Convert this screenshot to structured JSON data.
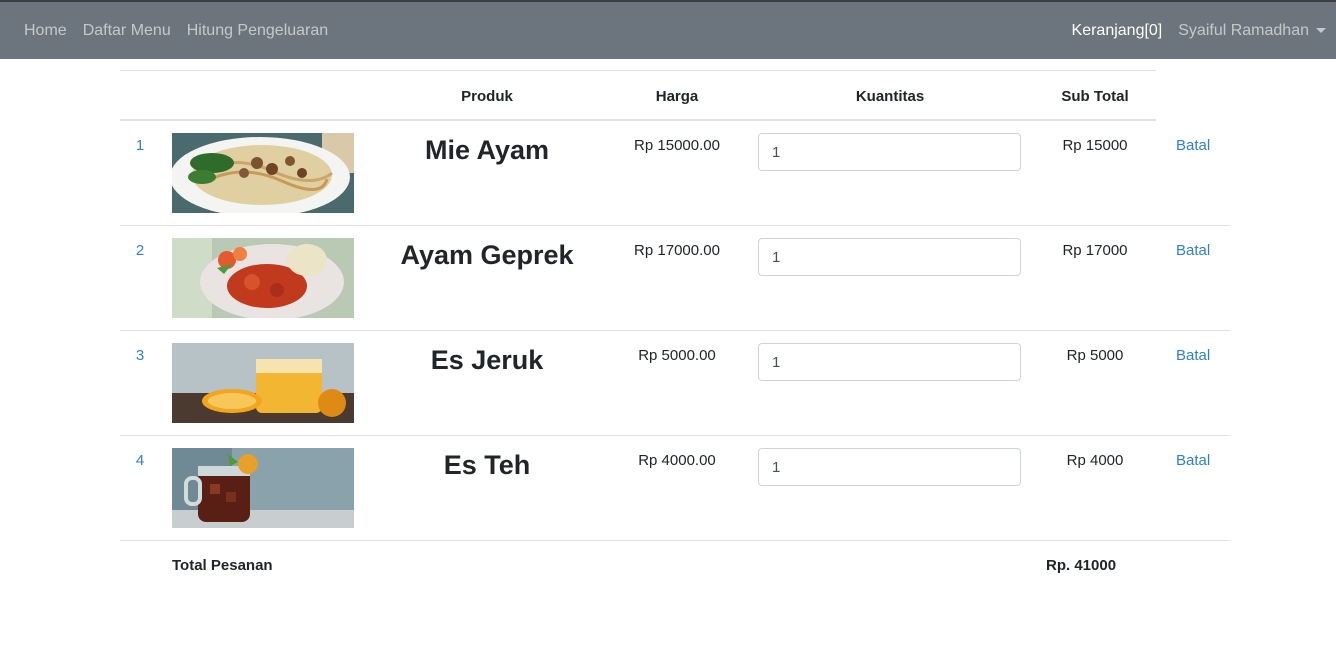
{
  "navbar": {
    "links": [
      "Home",
      "Daftar Menu",
      "Hitung Pengeluaran"
    ],
    "cart": "Keranjang[0]",
    "user": "Syaiful Ramadhan"
  },
  "table": {
    "headers": {
      "produk": "Produk",
      "harga": "Harga",
      "kuantitas": "Kuantitas",
      "subtotal": "Sub Total"
    },
    "rows": [
      {
        "no": "1",
        "image": "mie-ayam-photo",
        "name": "Mie Ayam",
        "price": "Rp 15000.00",
        "qty": "1",
        "subtotal": "Rp 15000",
        "action": "Batal"
      },
      {
        "no": "2",
        "image": "ayam-geprek-photo",
        "name": "Ayam Geprek",
        "price": "Rp 17000.00",
        "qty": "1",
        "subtotal": "Rp 17000",
        "action": "Batal"
      },
      {
        "no": "3",
        "image": "es-jeruk-photo",
        "name": "Es Jeruk",
        "price": "Rp 5000.00",
        "qty": "1",
        "subtotal": "Rp 5000",
        "action": "Batal"
      },
      {
        "no": "4",
        "image": "es-teh-photo",
        "name": "Es Teh",
        "price": "Rp 4000.00",
        "qty": "1",
        "subtotal": "Rp 4000",
        "action": "Batal"
      }
    ],
    "total_label": "Total Pesanan",
    "total_value": "Rp. 41000"
  },
  "colors": {
    "navbar_bg": "#6c757d",
    "link": "#2f7fd1",
    "border": "#dee2e6"
  }
}
